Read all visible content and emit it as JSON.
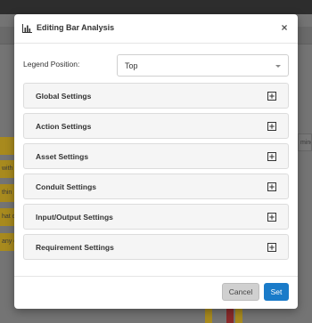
{
  "background": {
    "cells": [
      "with",
      "thin",
      "hat c",
      "any c",
      "ming"
    ]
  },
  "modal": {
    "title": "Editing Bar Analysis",
    "title_icon": "bar-chart-icon",
    "close_label": "×",
    "legend": {
      "label": "Legend Position:",
      "value": "Top"
    },
    "sections": [
      {
        "label": "Global Settings"
      },
      {
        "label": "Action Settings"
      },
      {
        "label": "Asset Settings"
      },
      {
        "label": "Conduit Settings"
      },
      {
        "label": "Input/Output Settings"
      },
      {
        "label": "Requirement Settings"
      }
    ],
    "buttons": {
      "cancel": "Cancel",
      "set": "Set"
    }
  },
  "colors": {
    "primary": "#1a7bc9",
    "cancel": "#d0d0d0",
    "overlay_highlight": "#a88a1e"
  }
}
